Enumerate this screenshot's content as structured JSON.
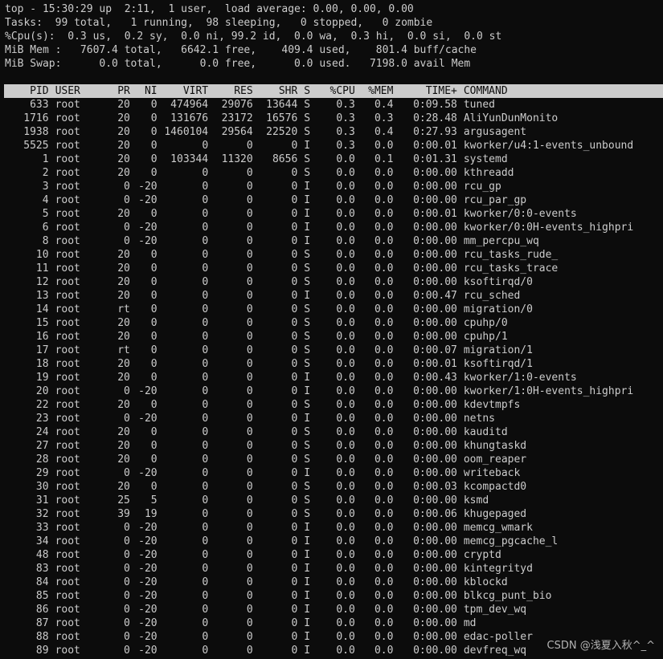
{
  "summary": [
    "top - 15:30:29 up  2:11,  1 user,  load average: 0.00, 0.00, 0.00",
    "Tasks:  99 total,   1 running,  98 sleeping,   0 stopped,   0 zombie",
    "%Cpu(s):  0.3 us,  0.2 sy,  0.0 ni, 99.2 id,  0.0 wa,  0.3 hi,  0.0 si,  0.0 st",
    "MiB Mem :   7607.4 total,   6642.1 free,    409.4 used,    801.4 buff/cache",
    "MiB Swap:      0.0 total,      0.0 free,      0.0 used.   7198.0 avail Mem"
  ],
  "columns": {
    "pid": "PID",
    "user": "USER",
    "pr": "PR",
    "ni": "NI",
    "virt": "VIRT",
    "res": "RES",
    "shr": "SHR",
    "s": "S",
    "cpu": "%CPU",
    "mem": "%MEM",
    "time": "TIME+",
    "cmd": "COMMAND"
  },
  "processes": [
    {
      "pid": "633",
      "user": "root",
      "pr": "20",
      "ni": "0",
      "virt": "474964",
      "res": "29076",
      "shr": "13644",
      "s": "S",
      "cpu": "0.3",
      "mem": "0.4",
      "time": "0:09.58",
      "cmd": "tuned"
    },
    {
      "pid": "1716",
      "user": "root",
      "pr": "20",
      "ni": "0",
      "virt": "131676",
      "res": "23172",
      "shr": "16576",
      "s": "S",
      "cpu": "0.3",
      "mem": "0.3",
      "time": "0:28.48",
      "cmd": "AliYunDunMonito"
    },
    {
      "pid": "1938",
      "user": "root",
      "pr": "20",
      "ni": "0",
      "virt": "1460104",
      "res": "29564",
      "shr": "22520",
      "s": "S",
      "cpu": "0.3",
      "mem": "0.4",
      "time": "0:27.93",
      "cmd": "argusagent"
    },
    {
      "pid": "5525",
      "user": "root",
      "pr": "20",
      "ni": "0",
      "virt": "0",
      "res": "0",
      "shr": "0",
      "s": "I",
      "cpu": "0.3",
      "mem": "0.0",
      "time": "0:00.01",
      "cmd": "kworker/u4:1-events_unbound"
    },
    {
      "pid": "1",
      "user": "root",
      "pr": "20",
      "ni": "0",
      "virt": "103344",
      "res": "11320",
      "shr": "8656",
      "s": "S",
      "cpu": "0.0",
      "mem": "0.1",
      "time": "0:01.31",
      "cmd": "systemd"
    },
    {
      "pid": "2",
      "user": "root",
      "pr": "20",
      "ni": "0",
      "virt": "0",
      "res": "0",
      "shr": "0",
      "s": "S",
      "cpu": "0.0",
      "mem": "0.0",
      "time": "0:00.00",
      "cmd": "kthreadd"
    },
    {
      "pid": "3",
      "user": "root",
      "pr": "0",
      "ni": "-20",
      "virt": "0",
      "res": "0",
      "shr": "0",
      "s": "I",
      "cpu": "0.0",
      "mem": "0.0",
      "time": "0:00.00",
      "cmd": "rcu_gp"
    },
    {
      "pid": "4",
      "user": "root",
      "pr": "0",
      "ni": "-20",
      "virt": "0",
      "res": "0",
      "shr": "0",
      "s": "I",
      "cpu": "0.0",
      "mem": "0.0",
      "time": "0:00.00",
      "cmd": "rcu_par_gp"
    },
    {
      "pid": "5",
      "user": "root",
      "pr": "20",
      "ni": "0",
      "virt": "0",
      "res": "0",
      "shr": "0",
      "s": "I",
      "cpu": "0.0",
      "mem": "0.0",
      "time": "0:00.01",
      "cmd": "kworker/0:0-events"
    },
    {
      "pid": "6",
      "user": "root",
      "pr": "0",
      "ni": "-20",
      "virt": "0",
      "res": "0",
      "shr": "0",
      "s": "I",
      "cpu": "0.0",
      "mem": "0.0",
      "time": "0:00.00",
      "cmd": "kworker/0:0H-events_highpri"
    },
    {
      "pid": "8",
      "user": "root",
      "pr": "0",
      "ni": "-20",
      "virt": "0",
      "res": "0",
      "shr": "0",
      "s": "I",
      "cpu": "0.0",
      "mem": "0.0",
      "time": "0:00.00",
      "cmd": "mm_percpu_wq"
    },
    {
      "pid": "10",
      "user": "root",
      "pr": "20",
      "ni": "0",
      "virt": "0",
      "res": "0",
      "shr": "0",
      "s": "S",
      "cpu": "0.0",
      "mem": "0.0",
      "time": "0:00.00",
      "cmd": "rcu_tasks_rude_"
    },
    {
      "pid": "11",
      "user": "root",
      "pr": "20",
      "ni": "0",
      "virt": "0",
      "res": "0",
      "shr": "0",
      "s": "S",
      "cpu": "0.0",
      "mem": "0.0",
      "time": "0:00.00",
      "cmd": "rcu_tasks_trace"
    },
    {
      "pid": "12",
      "user": "root",
      "pr": "20",
      "ni": "0",
      "virt": "0",
      "res": "0",
      "shr": "0",
      "s": "S",
      "cpu": "0.0",
      "mem": "0.0",
      "time": "0:00.00",
      "cmd": "ksoftirqd/0"
    },
    {
      "pid": "13",
      "user": "root",
      "pr": "20",
      "ni": "0",
      "virt": "0",
      "res": "0",
      "shr": "0",
      "s": "I",
      "cpu": "0.0",
      "mem": "0.0",
      "time": "0:00.47",
      "cmd": "rcu_sched"
    },
    {
      "pid": "14",
      "user": "root",
      "pr": "rt",
      "ni": "0",
      "virt": "0",
      "res": "0",
      "shr": "0",
      "s": "S",
      "cpu": "0.0",
      "mem": "0.0",
      "time": "0:00.00",
      "cmd": "migration/0"
    },
    {
      "pid": "15",
      "user": "root",
      "pr": "20",
      "ni": "0",
      "virt": "0",
      "res": "0",
      "shr": "0",
      "s": "S",
      "cpu": "0.0",
      "mem": "0.0",
      "time": "0:00.00",
      "cmd": "cpuhp/0"
    },
    {
      "pid": "16",
      "user": "root",
      "pr": "20",
      "ni": "0",
      "virt": "0",
      "res": "0",
      "shr": "0",
      "s": "S",
      "cpu": "0.0",
      "mem": "0.0",
      "time": "0:00.00",
      "cmd": "cpuhp/1"
    },
    {
      "pid": "17",
      "user": "root",
      "pr": "rt",
      "ni": "0",
      "virt": "0",
      "res": "0",
      "shr": "0",
      "s": "S",
      "cpu": "0.0",
      "mem": "0.0",
      "time": "0:00.07",
      "cmd": "migration/1"
    },
    {
      "pid": "18",
      "user": "root",
      "pr": "20",
      "ni": "0",
      "virt": "0",
      "res": "0",
      "shr": "0",
      "s": "S",
      "cpu": "0.0",
      "mem": "0.0",
      "time": "0:00.01",
      "cmd": "ksoftirqd/1"
    },
    {
      "pid": "19",
      "user": "root",
      "pr": "20",
      "ni": "0",
      "virt": "0",
      "res": "0",
      "shr": "0",
      "s": "I",
      "cpu": "0.0",
      "mem": "0.0",
      "time": "0:00.43",
      "cmd": "kworker/1:0-events"
    },
    {
      "pid": "20",
      "user": "root",
      "pr": "0",
      "ni": "-20",
      "virt": "0",
      "res": "0",
      "shr": "0",
      "s": "I",
      "cpu": "0.0",
      "mem": "0.0",
      "time": "0:00.00",
      "cmd": "kworker/1:0H-events_highpri"
    },
    {
      "pid": "22",
      "user": "root",
      "pr": "20",
      "ni": "0",
      "virt": "0",
      "res": "0",
      "shr": "0",
      "s": "S",
      "cpu": "0.0",
      "mem": "0.0",
      "time": "0:00.00",
      "cmd": "kdevtmpfs"
    },
    {
      "pid": "23",
      "user": "root",
      "pr": "0",
      "ni": "-20",
      "virt": "0",
      "res": "0",
      "shr": "0",
      "s": "I",
      "cpu": "0.0",
      "mem": "0.0",
      "time": "0:00.00",
      "cmd": "netns"
    },
    {
      "pid": "24",
      "user": "root",
      "pr": "20",
      "ni": "0",
      "virt": "0",
      "res": "0",
      "shr": "0",
      "s": "S",
      "cpu": "0.0",
      "mem": "0.0",
      "time": "0:00.00",
      "cmd": "kauditd"
    },
    {
      "pid": "27",
      "user": "root",
      "pr": "20",
      "ni": "0",
      "virt": "0",
      "res": "0",
      "shr": "0",
      "s": "S",
      "cpu": "0.0",
      "mem": "0.0",
      "time": "0:00.00",
      "cmd": "khungtaskd"
    },
    {
      "pid": "28",
      "user": "root",
      "pr": "20",
      "ni": "0",
      "virt": "0",
      "res": "0",
      "shr": "0",
      "s": "S",
      "cpu": "0.0",
      "mem": "0.0",
      "time": "0:00.00",
      "cmd": "oom_reaper"
    },
    {
      "pid": "29",
      "user": "root",
      "pr": "0",
      "ni": "-20",
      "virt": "0",
      "res": "0",
      "shr": "0",
      "s": "I",
      "cpu": "0.0",
      "mem": "0.0",
      "time": "0:00.00",
      "cmd": "writeback"
    },
    {
      "pid": "30",
      "user": "root",
      "pr": "20",
      "ni": "0",
      "virt": "0",
      "res": "0",
      "shr": "0",
      "s": "S",
      "cpu": "0.0",
      "mem": "0.0",
      "time": "0:00.03",
      "cmd": "kcompactd0"
    },
    {
      "pid": "31",
      "user": "root",
      "pr": "25",
      "ni": "5",
      "virt": "0",
      "res": "0",
      "shr": "0",
      "s": "S",
      "cpu": "0.0",
      "mem": "0.0",
      "time": "0:00.00",
      "cmd": "ksmd"
    },
    {
      "pid": "32",
      "user": "root",
      "pr": "39",
      "ni": "19",
      "virt": "0",
      "res": "0",
      "shr": "0",
      "s": "S",
      "cpu": "0.0",
      "mem": "0.0",
      "time": "0:00.06",
      "cmd": "khugepaged"
    },
    {
      "pid": "33",
      "user": "root",
      "pr": "0",
      "ni": "-20",
      "virt": "0",
      "res": "0",
      "shr": "0",
      "s": "I",
      "cpu": "0.0",
      "mem": "0.0",
      "time": "0:00.00",
      "cmd": "memcg_wmark"
    },
    {
      "pid": "34",
      "user": "root",
      "pr": "0",
      "ni": "-20",
      "virt": "0",
      "res": "0",
      "shr": "0",
      "s": "I",
      "cpu": "0.0",
      "mem": "0.0",
      "time": "0:00.00",
      "cmd": "memcg_pgcache_l"
    },
    {
      "pid": "48",
      "user": "root",
      "pr": "0",
      "ni": "-20",
      "virt": "0",
      "res": "0",
      "shr": "0",
      "s": "I",
      "cpu": "0.0",
      "mem": "0.0",
      "time": "0:00.00",
      "cmd": "cryptd"
    },
    {
      "pid": "83",
      "user": "root",
      "pr": "0",
      "ni": "-20",
      "virt": "0",
      "res": "0",
      "shr": "0",
      "s": "I",
      "cpu": "0.0",
      "mem": "0.0",
      "time": "0:00.00",
      "cmd": "kintegrityd"
    },
    {
      "pid": "84",
      "user": "root",
      "pr": "0",
      "ni": "-20",
      "virt": "0",
      "res": "0",
      "shr": "0",
      "s": "I",
      "cpu": "0.0",
      "mem": "0.0",
      "time": "0:00.00",
      "cmd": "kblockd"
    },
    {
      "pid": "85",
      "user": "root",
      "pr": "0",
      "ni": "-20",
      "virt": "0",
      "res": "0",
      "shr": "0",
      "s": "I",
      "cpu": "0.0",
      "mem": "0.0",
      "time": "0:00.00",
      "cmd": "blkcg_punt_bio"
    },
    {
      "pid": "86",
      "user": "root",
      "pr": "0",
      "ni": "-20",
      "virt": "0",
      "res": "0",
      "shr": "0",
      "s": "I",
      "cpu": "0.0",
      "mem": "0.0",
      "time": "0:00.00",
      "cmd": "tpm_dev_wq"
    },
    {
      "pid": "87",
      "user": "root",
      "pr": "0",
      "ni": "-20",
      "virt": "0",
      "res": "0",
      "shr": "0",
      "s": "I",
      "cpu": "0.0",
      "mem": "0.0",
      "time": "0:00.00",
      "cmd": "md"
    },
    {
      "pid": "88",
      "user": "root",
      "pr": "0",
      "ni": "-20",
      "virt": "0",
      "res": "0",
      "shr": "0",
      "s": "I",
      "cpu": "0.0",
      "mem": "0.0",
      "time": "0:00.00",
      "cmd": "edac-poller"
    },
    {
      "pid": "89",
      "user": "root",
      "pr": "0",
      "ni": "-20",
      "virt": "0",
      "res": "0",
      "shr": "0",
      "s": "I",
      "cpu": "0.0",
      "mem": "0.0",
      "time": "0:00.00",
      "cmd": "devfreq_wq"
    }
  ],
  "watermark": "CSDN @浅夏入秋^_^",
  "colors": {
    "background": "#0c0c0c",
    "foreground": "#cccccc",
    "header_bg": "#cccccc",
    "header_fg": "#0c0c0c"
  }
}
